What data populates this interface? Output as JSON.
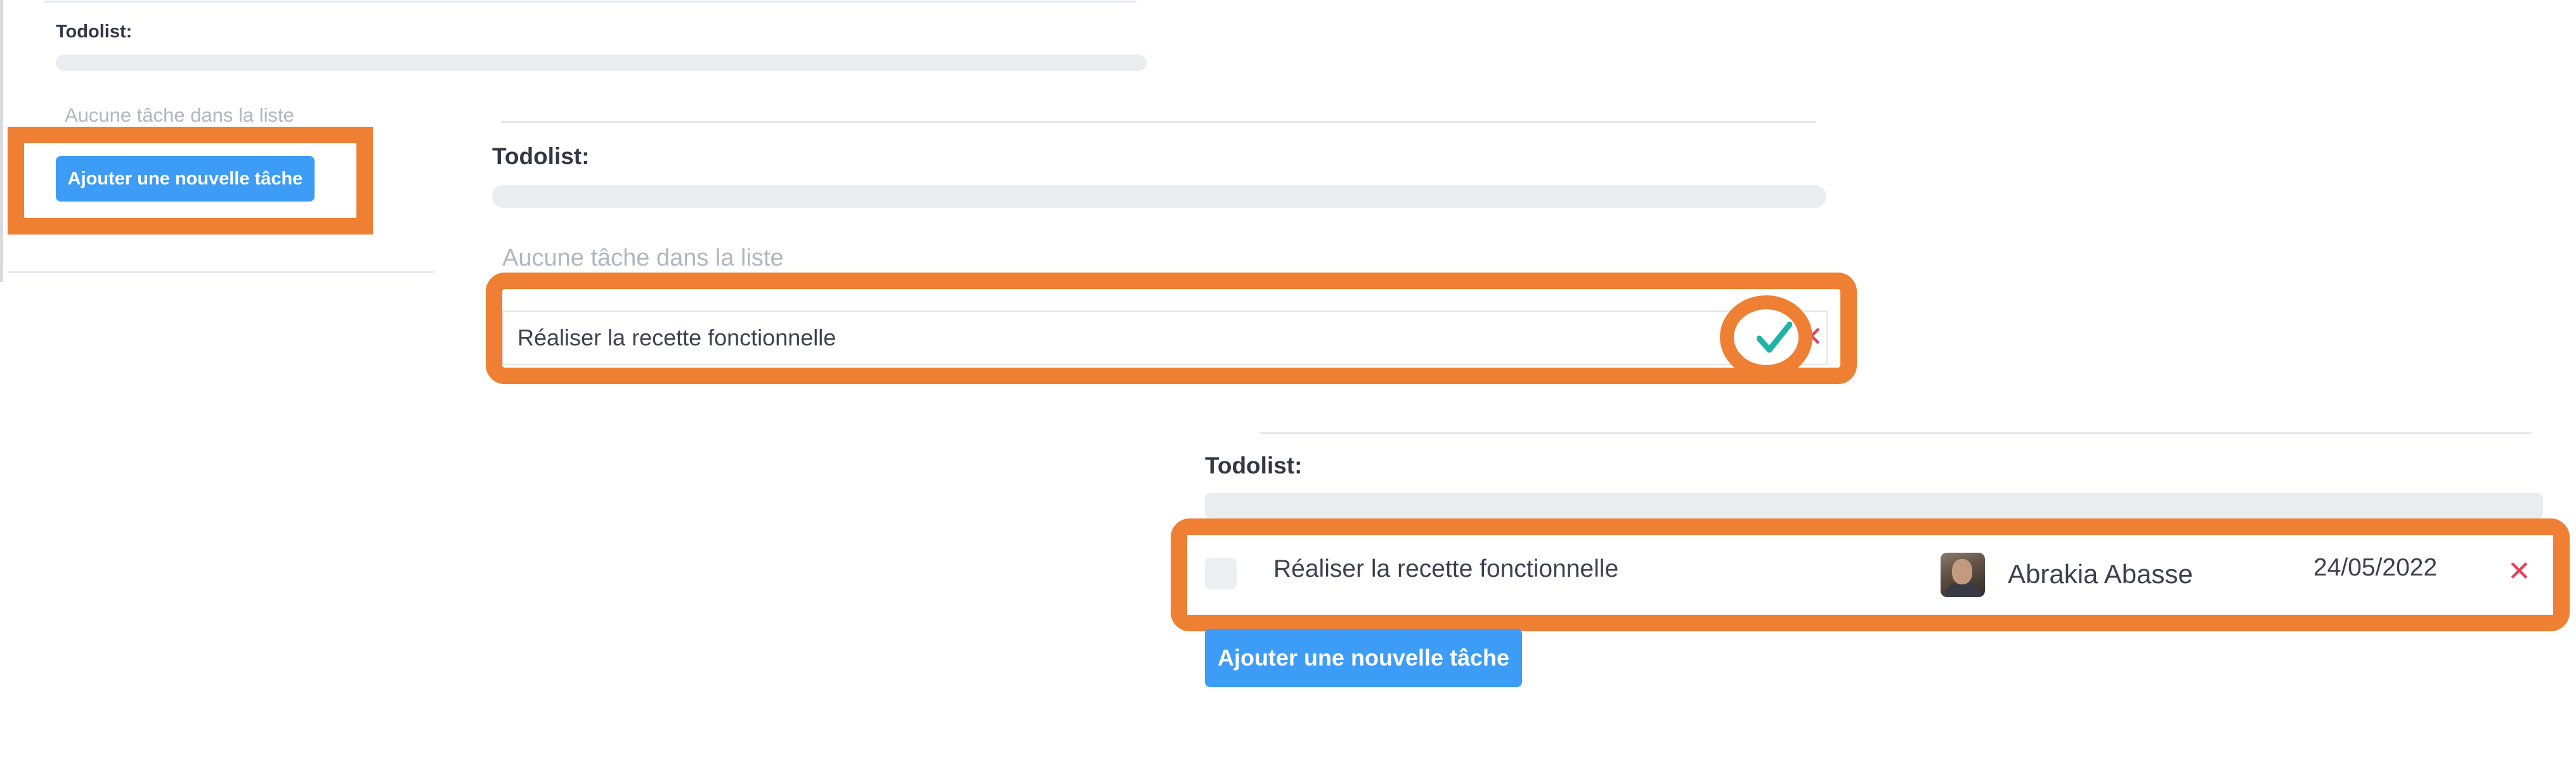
{
  "panel1": {
    "title": "Todolist:",
    "progress_percent": 0,
    "empty_message": "Aucune tâche dans la liste",
    "add_button": "Ajouter une nouvelle tâche"
  },
  "panel2": {
    "title": "Todolist:",
    "progress_percent": 0,
    "empty_message": "Aucune tâche dans la liste",
    "new_task_value": "Réaliser la recette fonctionnelle",
    "confirm_icon": "check-icon",
    "cancel_icon": "close-icon",
    "cancel_glyph": "✕"
  },
  "panel3": {
    "title": "Todolist:",
    "progress_percent": 0,
    "task": {
      "label": "Réaliser la recette fonctionnelle",
      "assignee": "Abrakia Abasse",
      "date": "24/05/2022",
      "done": false,
      "delete_glyph": "✕"
    },
    "add_button": "Ajouter une nouvelle tâche"
  },
  "colors": {
    "highlight": "#ee7f33",
    "button": "#3d9cf5",
    "check": "#1fb5a6",
    "delete": "#e8405c"
  }
}
